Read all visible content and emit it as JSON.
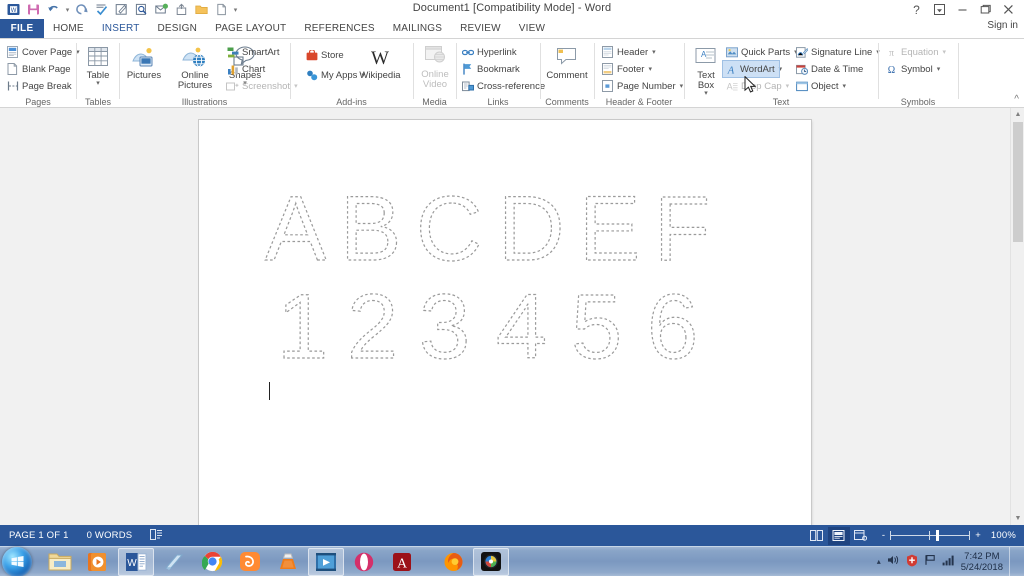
{
  "window": {
    "title": "Document1 [Compatibility Mode] - Word",
    "signin": "Sign in",
    "help_icon": "help-icon",
    "ribbon_display_icon": "ribbon-display-options-icon",
    "minimize_icon": "minimize-icon",
    "restore_icon": "restore-icon",
    "close_icon": "close-icon"
  },
  "quick_access": [
    {
      "name": "word-logo-icon",
      "label": "W"
    },
    {
      "name": "save-icon",
      "label": "Save"
    },
    {
      "name": "undo-icon",
      "label": "Undo"
    },
    {
      "name": "redo-icon",
      "label": "Redo"
    },
    {
      "name": "spelling-grammar-icon",
      "label": "Spelling & Grammar"
    },
    {
      "name": "edit-icon",
      "label": "Edit"
    },
    {
      "name": "print-preview-icon",
      "label": "Print Preview and Print"
    },
    {
      "name": "email-icon",
      "label": "E-mail"
    },
    {
      "name": "save-as-icon",
      "label": "Save As"
    },
    {
      "name": "open-icon",
      "label": "Open"
    },
    {
      "name": "new-icon",
      "label": "New"
    },
    {
      "name": "customize-quick-access-toolbar-icon",
      "label": "Customize Quick Access Toolbar"
    }
  ],
  "tabs": [
    {
      "label": "FILE",
      "active": false,
      "file": true
    },
    {
      "label": "HOME",
      "active": false
    },
    {
      "label": "INSERT",
      "active": true
    },
    {
      "label": "DESIGN",
      "active": false
    },
    {
      "label": "PAGE LAYOUT",
      "active": false
    },
    {
      "label": "REFERENCES",
      "active": false
    },
    {
      "label": "MAILINGS",
      "active": false
    },
    {
      "label": "REVIEW",
      "active": false
    },
    {
      "label": "VIEW",
      "active": false
    }
  ],
  "ribbon": {
    "collapse_label": "^",
    "groups": [
      {
        "name": "pages",
        "label": "Pages",
        "items": [
          {
            "label": "Cover Page",
            "icon": "cover-page-icon",
            "caret": true,
            "disabled": false
          },
          {
            "label": "Blank Page",
            "icon": "blank-page-icon",
            "caret": false,
            "disabled": false
          },
          {
            "label": "Page Break",
            "icon": "page-break-icon",
            "caret": false,
            "disabled": false
          }
        ]
      },
      {
        "name": "tables",
        "label": "Tables",
        "items": [
          {
            "label": "Table",
            "icon": "table-icon",
            "caret": true,
            "big": true
          }
        ]
      },
      {
        "name": "illustrations",
        "label": "Illustrations",
        "items": [
          {
            "label": "Pictures",
            "icon": "pictures-icon",
            "big": true
          },
          {
            "label": "Online Pictures",
            "icon": "online-pictures-icon",
            "big": true
          },
          {
            "label": "Shapes",
            "icon": "shapes-icon",
            "caret": true,
            "big": true
          },
          {
            "label": "SmartArt",
            "icon": "smartart-icon"
          },
          {
            "label": "Chart",
            "icon": "chart-icon"
          },
          {
            "label": "Screenshot",
            "icon": "screenshot-icon",
            "caret": true,
            "disabled": true
          }
        ]
      },
      {
        "name": "add-ins",
        "label": "Add-ins",
        "items": [
          {
            "label": "Store",
            "icon": "store-icon"
          },
          {
            "label": "My Apps",
            "icon": "my-apps-icon",
            "caret": true
          },
          {
            "label": "Wikipedia",
            "icon": "wikipedia-icon",
            "big": true
          }
        ]
      },
      {
        "name": "media",
        "label": "Media",
        "items": [
          {
            "label": "Online Video",
            "icon": "online-video-icon",
            "big": true,
            "disabled": true
          }
        ]
      },
      {
        "name": "links",
        "label": "Links",
        "items": [
          {
            "label": "Hyperlink",
            "icon": "hyperlink-icon"
          },
          {
            "label": "Bookmark",
            "icon": "bookmark-icon"
          },
          {
            "label": "Cross-reference",
            "icon": "cross-reference-icon"
          }
        ]
      },
      {
        "name": "comments",
        "label": "Comments",
        "items": [
          {
            "label": "Comment",
            "icon": "comment-icon",
            "big": true
          }
        ]
      },
      {
        "name": "header-footer",
        "label": "Header & Footer",
        "items": [
          {
            "label": "Header",
            "icon": "header-icon",
            "caret": true
          },
          {
            "label": "Footer",
            "icon": "footer-icon",
            "caret": true
          },
          {
            "label": "Page Number",
            "icon": "page-number-icon",
            "caret": true
          }
        ]
      },
      {
        "name": "text",
        "label": "Text",
        "items": [
          {
            "label": "Text Box",
            "icon": "text-box-icon",
            "caret": true,
            "big": true
          },
          {
            "label": "Quick Parts",
            "icon": "quick-parts-icon",
            "caret": true
          },
          {
            "label": "WordArt",
            "icon": "wordart-icon",
            "caret": true,
            "selected": true
          },
          {
            "label": "Drop Cap",
            "icon": "drop-cap-icon",
            "caret": true,
            "disabled": true
          },
          {
            "label": "Signature Line",
            "icon": "signature-line-icon",
            "caret": true
          },
          {
            "label": "Date & Time",
            "icon": "date-time-icon"
          },
          {
            "label": "Object",
            "icon": "object-icon",
            "caret": true
          }
        ]
      },
      {
        "name": "symbols",
        "label": "Symbols",
        "items": [
          {
            "label": "Equation",
            "icon": "equation-icon",
            "caret": true,
            "disabled": true
          },
          {
            "label": "Symbol",
            "icon": "symbol-icon",
            "caret": true
          }
        ]
      }
    ]
  },
  "document": {
    "tracing_rows": [
      [
        "A",
        "B",
        "C",
        "D",
        "E",
        "F"
      ],
      [
        "1",
        "2",
        "3",
        "4",
        "5",
        "6"
      ]
    ],
    "outline_color": "#9a9a9a",
    "caret_visible": true
  },
  "status_bar": {
    "page_label": "PAGE 1 OF 1",
    "word_count": "0 WORDS",
    "proofing_icon": "proofing-errors-icon",
    "view_buttons": [
      {
        "name": "read-mode-icon",
        "active": false
      },
      {
        "name": "print-layout-icon",
        "active": true
      },
      {
        "name": "web-layout-icon",
        "active": false
      }
    ],
    "zoom_out": "-",
    "zoom_in": "+",
    "zoom_level": "100%",
    "accent_color": "#2b579a"
  },
  "taskbar": {
    "start_icon": "windows-start-orb-icon",
    "items": [
      {
        "name": "file-explorer-icon",
        "open": false
      },
      {
        "name": "media-player-icon",
        "open": false
      },
      {
        "name": "word-icon",
        "open": true
      },
      {
        "name": "notepad-icon",
        "open": false
      },
      {
        "name": "chrome-icon",
        "open": false
      },
      {
        "name": "uc-browser-icon",
        "open": false
      },
      {
        "name": "vlc-icon",
        "open": false
      },
      {
        "name": "video-editor-icon",
        "open": true
      },
      {
        "name": "opera-icon",
        "open": false
      },
      {
        "name": "adobe-reader-icon",
        "open": false
      },
      {
        "name": "firefox-icon",
        "open": false
      },
      {
        "name": "camera-app-icon",
        "open": true
      }
    ],
    "tray": [
      {
        "name": "show-hidden-icons-icon"
      },
      {
        "name": "volume-icon"
      },
      {
        "name": "antivirus-icon"
      },
      {
        "name": "action-center-flag-icon"
      },
      {
        "name": "network-signal-icon"
      }
    ],
    "clock_time": "7:42 PM",
    "clock_date": "5/24/2018"
  }
}
